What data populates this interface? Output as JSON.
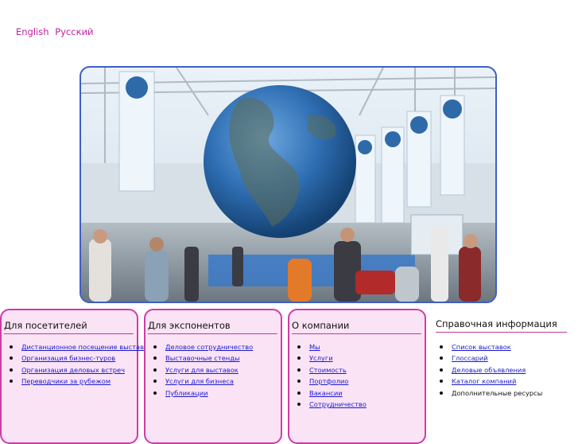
{
  "languages": {
    "english": "English",
    "russian": "Русский"
  },
  "sections": [
    {
      "title": "Для посетителей",
      "links": [
        "Дистанционное посещение выставок",
        "Организация бизнес-туров",
        "Организация деловых встреч",
        "Переводчики за рубежом"
      ]
    },
    {
      "title": "Для экспонентов",
      "links": [
        "Деловое сотрудничество",
        "Выставочные стенды",
        "Услуги для выставок",
        "Услуги для бизнеса",
        "Публикации"
      ]
    },
    {
      "title": "О компании",
      "links": [
        "Мы",
        "Услуги",
        "Стоимость",
        "Портфолио",
        "Вакансии",
        "Сотрудничество"
      ]
    },
    {
      "title": "Справочная информация",
      "links": [
        "Список выставок",
        "Глоссарий",
        "Деловые объявления",
        "Каталог компаний"
      ],
      "static": "Дополнительные ресурсы"
    }
  ],
  "colors": {
    "accent": "#c01f9e",
    "link": "#1a1ad0",
    "card_bg": "#fbe3f6",
    "card_border": "#d23aa5",
    "hero_border": "#3f5fc4"
  }
}
